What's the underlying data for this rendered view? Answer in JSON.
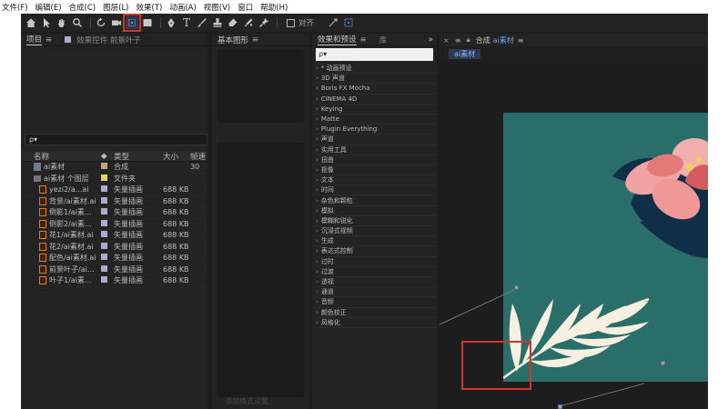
{
  "menubar": {
    "items": [
      "文件(F)",
      "编辑(E)",
      "合成(C)",
      "图层(L)",
      "效果(T)",
      "动画(A)",
      "视图(V)",
      "窗口",
      "帮助(H)"
    ]
  },
  "toolbar": {
    "align_label": "对齐"
  },
  "project_panel": {
    "tab_label": "项目",
    "secondary_tab": "效果控件 前景叶子",
    "search_placeholder": "ρ▾",
    "columns": {
      "name": "名称",
      "type": "类型",
      "size": "大小",
      "fps": "帧速"
    },
    "rows": [
      {
        "name": "ai素材",
        "type": "合成",
        "size": "",
        "fps": "30",
        "icon": "comp-icon",
        "color": "#c7a27b",
        "indent": false
      },
      {
        "name": "ai素材 个图层",
        "type": "文件夹",
        "size": "",
        "fps": "",
        "icon": "folder-icon",
        "color": "#e8d65a",
        "indent": false
      },
      {
        "name": "yezi2/a...ai",
        "type": "矢量插画",
        "size": "688 KB",
        "fps": "",
        "icon": "ai-file-icon",
        "color": "#b0a8d8",
        "indent": true
      },
      {
        "name": "背景/ai素材.ai",
        "type": "矢量插画",
        "size": "688 KB",
        "fps": "",
        "icon": "ai-file-icon",
        "color": "#b0a8d8",
        "indent": true
      },
      {
        "name": "倒影1/ai素...",
        "type": "矢量插画",
        "size": "688 KB",
        "fps": "",
        "icon": "ai-file-icon",
        "color": "#b0a8d8",
        "indent": true
      },
      {
        "name": "倒影2/ai素...",
        "type": "矢量插画",
        "size": "688 KB",
        "fps": "",
        "icon": "ai-file-icon",
        "color": "#b0a8d8",
        "indent": true
      },
      {
        "name": "花1/ai素材.ai",
        "type": "矢量插画",
        "size": "688 KB",
        "fps": "",
        "icon": "ai-file-icon",
        "color": "#b0a8d8",
        "indent": true
      },
      {
        "name": "花2/ai素材.ai",
        "type": "矢量插画",
        "size": "688 KB",
        "fps": "",
        "icon": "ai-file-icon",
        "color": "#b0a8d8",
        "indent": true
      },
      {
        "name": "配色/ai素材.ai",
        "type": "矢量插画",
        "size": "688 KB",
        "fps": "",
        "icon": "ai-file-icon",
        "color": "#b0a8d8",
        "indent": true
      },
      {
        "name": "前景叶子/ai...",
        "type": "矢量插画",
        "size": "688 KB",
        "fps": "",
        "icon": "ai-file-icon",
        "color": "#b0a8d8",
        "indent": true
      },
      {
        "name": "叶子1/ai素...",
        "type": "矢量插画",
        "size": "688 KB",
        "fps": "",
        "icon": "ai-file-icon",
        "color": "#b0a8d8",
        "indent": true
      }
    ]
  },
  "essential_graphics": {
    "tab_label": "基本图形",
    "footer": "添加格式设置"
  },
  "effects_panel": {
    "tab_label": "效果和预设",
    "secondary_tab": "库",
    "search_placeholder": "ρ▾",
    "items": [
      "* 动画预设",
      "3D 声道",
      "Boris FX Mocha",
      "CINEMA 4D",
      "Keying",
      "Matte",
      "Plugin Everything",
      "声道",
      "实用工具",
      "扭曲",
      "抠像",
      "文本",
      "时间",
      "杂色和颗粒",
      "模拟",
      "模糊和锐化",
      "沉浸式视频",
      "生成",
      "表达式控制",
      "过时",
      "过渡",
      "透视",
      "通道",
      "音频",
      "颜色校正",
      "风格化"
    ]
  },
  "composition_panel": {
    "tab_prefix": "合成",
    "tab_name": "ai素材",
    "subtab": "ai素材"
  },
  "colors": {
    "canvas_bg": "#2a6e6a",
    "flower_pink": "#f0a3a0",
    "leaf_dark": "#0f2e48",
    "leaf_cream": "#f5f0e0",
    "highlight_red": "#d6312b"
  }
}
